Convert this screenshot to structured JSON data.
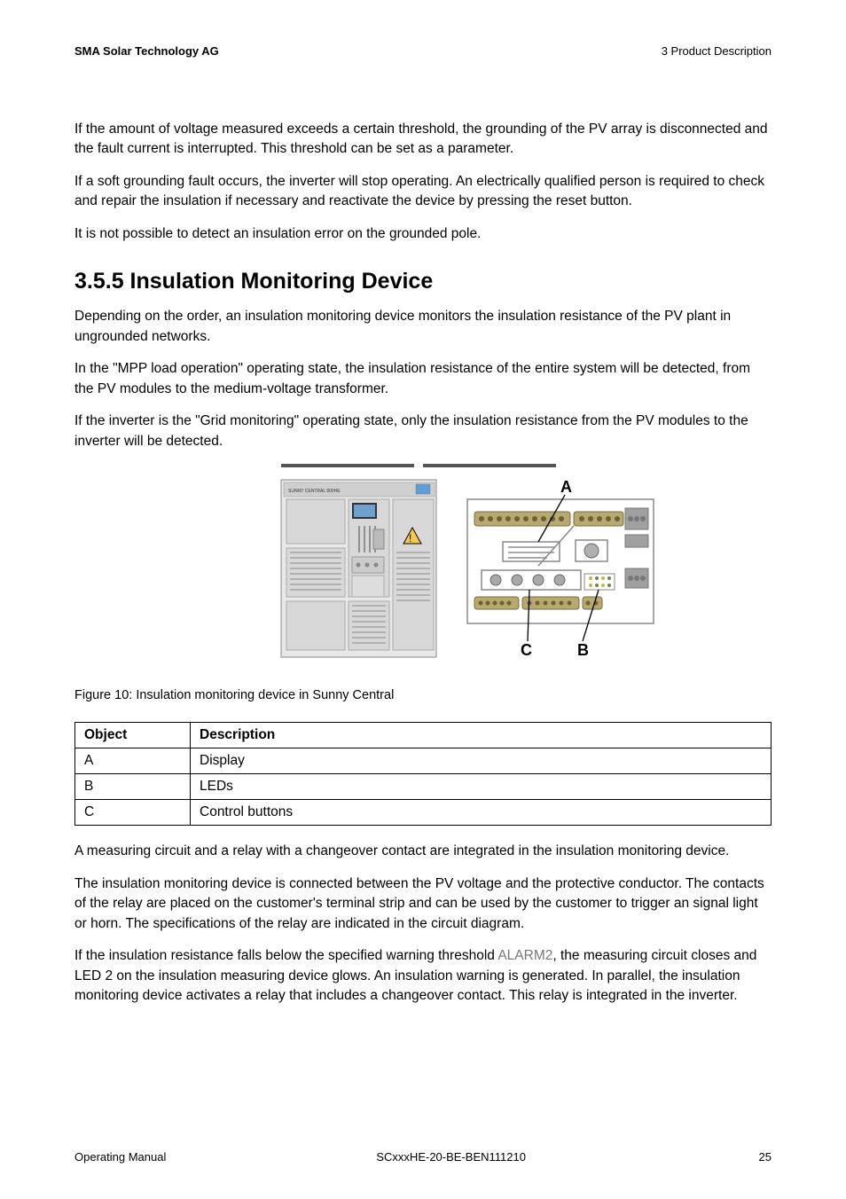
{
  "header": {
    "company": "SMA Solar Technology AG",
    "breadcrumb": "3  Product Description"
  },
  "paragraphs": {
    "p1": "If the amount of voltage measured exceeds a certain threshold, the grounding of the PV array is disconnected and the fault current is interrupted. This threshold can be set as a parameter.",
    "p2": "If a soft grounding fault occurs, the inverter will stop operating. An electrically qualified person is required to check and repair the insulation if necessary and reactivate the device by pressing the reset button.",
    "p3": "It is not possible to detect an insulation error on the grounded pole.",
    "heading": "3.5.5  Insulation Monitoring Device",
    "p4": "Depending on the order, an insulation monitoring device monitors the insulation resistance of the PV plant in ungrounded networks.",
    "p5": "In the \"MPP load operation\" operating state, the insulation resistance of the entire system will be detected, from the PV modules to the medium-voltage transformer.",
    "p6": "If the inverter is the \"Grid monitoring\" operating state, only the insulation resistance from the PV modules to the inverter will be detected.",
    "caption": "Figure 10:  Insulation monitoring device in Sunny Central",
    "p7": "A measuring circuit and a relay with a changeover contact are integrated in the insulation monitoring device.",
    "p8": "The insulation monitoring device is connected between the PV voltage and the protective conductor. The contacts of the relay are placed on the customer's terminal strip and can be used by the customer to trigger an signal light or horn. The specifications of the relay are indicated in the circuit diagram.",
    "p9a": "If the insulation resistance falls below the specified warning threshold ",
    "p9_code": "ALARM2",
    "p9b": ", the measuring circuit closes and LED 2 on the insulation measuring device glows. An insulation warning is generated. In parallel, the insulation monitoring device activates a relay that includes a changeover contact. This relay is integrated in the inverter."
  },
  "table": {
    "head_object": "Object",
    "head_description": "Description",
    "rows": [
      {
        "obj": "A",
        "desc": "Display"
      },
      {
        "obj": "B",
        "desc": "LEDs"
      },
      {
        "obj": "C",
        "desc": "Control buttons"
      }
    ]
  },
  "figure": {
    "labelA": "A",
    "labelB": "B",
    "labelC": "C",
    "panel_label": "SUNNY CENTRAL 800HE",
    "device_label": "",
    "warning": "⚠"
  },
  "footer": {
    "left": "Operating Manual",
    "center": "SCxxxHE-20-BE-BEN111210",
    "page": "25"
  }
}
